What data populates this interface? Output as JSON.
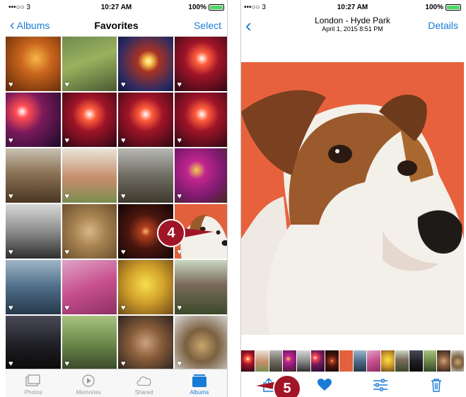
{
  "left": {
    "status": {
      "carrier": "•••○○ 3",
      "time": "10:27 AM",
      "battery": "100%"
    },
    "nav": {
      "back_label": "Albums",
      "title": "Favorites",
      "action_label": "Select"
    },
    "photos": [
      "p-amber",
      "p-fence",
      "p-sunblue",
      "p-sunred",
      "p-sunpurple",
      "p-sunred",
      "p-sunred",
      "p-sunred",
      "p-ruin",
      "p-arch",
      "p-castle",
      "p-flower",
      "p-stairs",
      "p-rosewin",
      "p-moon",
      "p-dog",
      "p-car",
      "p-pink",
      "p-food",
      "p-house",
      "p-dusk",
      "p-path",
      "p-mask",
      "p-pot"
    ],
    "tabs": [
      {
        "label": "Photos",
        "icon": "photos-icon",
        "active": false
      },
      {
        "label": "Memories",
        "icon": "memories-icon",
        "active": false
      },
      {
        "label": "Shared",
        "icon": "cloud-icon",
        "active": false
      },
      {
        "label": "Albums",
        "icon": "albums-icon",
        "active": true
      }
    ],
    "callout": "4"
  },
  "right": {
    "status": {
      "carrier": "•••○○ 3",
      "time": "10:27 AM",
      "battery": "100%"
    },
    "nav": {
      "title": "London - Hyde Park",
      "subtitle": "April 1, 2015  8:51 PM",
      "action_label": "Details"
    },
    "callout": "5",
    "filmstrip": [
      "p-sunred",
      "p-arch",
      "p-castle",
      "p-flower",
      "p-stairs",
      "p-sunpurple",
      "p-moon",
      "p-dog",
      "p-car",
      "p-pink",
      "p-food",
      "p-house",
      "p-dusk",
      "p-path",
      "p-mask",
      "p-pot"
    ]
  },
  "colors": {
    "accent": "#1a7bd6",
    "callout": "#a01528"
  }
}
